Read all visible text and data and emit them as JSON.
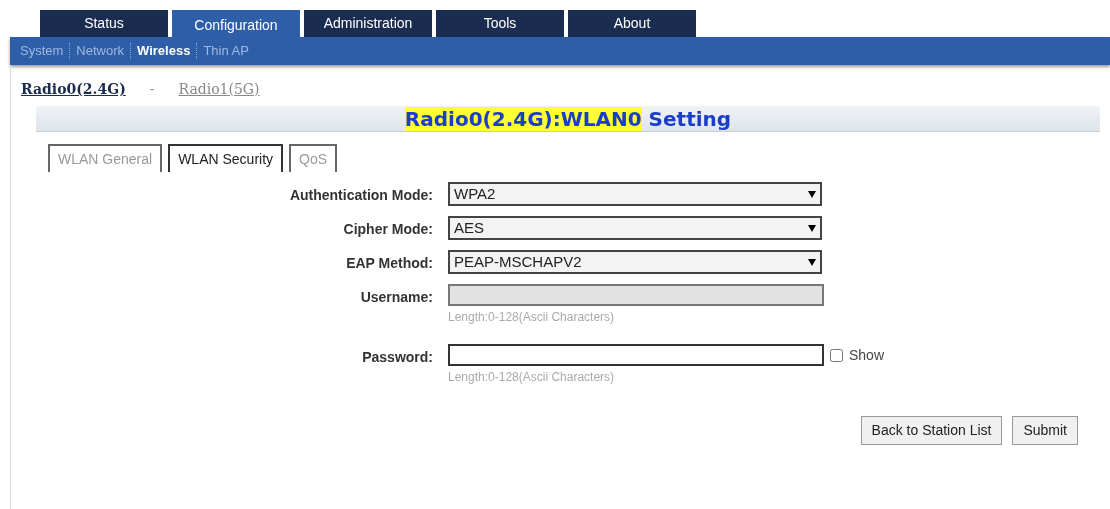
{
  "main_tabs": [
    {
      "label": "Status",
      "selected": false
    },
    {
      "label": "Configuration",
      "selected": true
    },
    {
      "label": "Administration",
      "selected": false
    },
    {
      "label": "Tools",
      "selected": false
    },
    {
      "label": "About",
      "selected": false
    }
  ],
  "sub_nav": [
    {
      "label": "System",
      "selected": false
    },
    {
      "label": "Network",
      "selected": false
    },
    {
      "label": "Wireless",
      "selected": true
    },
    {
      "label": "Thin AP",
      "selected": false
    }
  ],
  "radios": [
    {
      "label": "Radio0(2.4G)",
      "selected": true
    },
    {
      "label": "Radio1(5G)",
      "selected": false
    }
  ],
  "radio_separator": "-",
  "section_title": {
    "highlighted": "Radio0(2.4G):WLAN0",
    "rest": " Setting"
  },
  "tabs": [
    {
      "label": "WLAN General",
      "selected": false,
      "disabled": true
    },
    {
      "label": "WLAN Security",
      "selected": true,
      "disabled": false
    },
    {
      "label": "QoS",
      "selected": false,
      "disabled": true
    }
  ],
  "fields": [
    {
      "kind": "select",
      "label": "Authentication Mode:",
      "value": "WPA2"
    },
    {
      "kind": "select",
      "label": "Cipher Mode:",
      "value": "AES"
    },
    {
      "kind": "select",
      "label": "EAP Method:",
      "value": "PEAP-MSCHAPV2"
    },
    {
      "kind": "text",
      "label": "Username:",
      "disabled": true,
      "hint": "Length:0-128(Ascii Characters)"
    },
    {
      "kind": "password",
      "label": "Password:",
      "disabled": false,
      "hint": "Length:0-128(Ascii Characters)",
      "show": {
        "label": "Show",
        "checked": false
      }
    }
  ],
  "buttons": [
    "Back to Station List",
    "Submit"
  ]
}
